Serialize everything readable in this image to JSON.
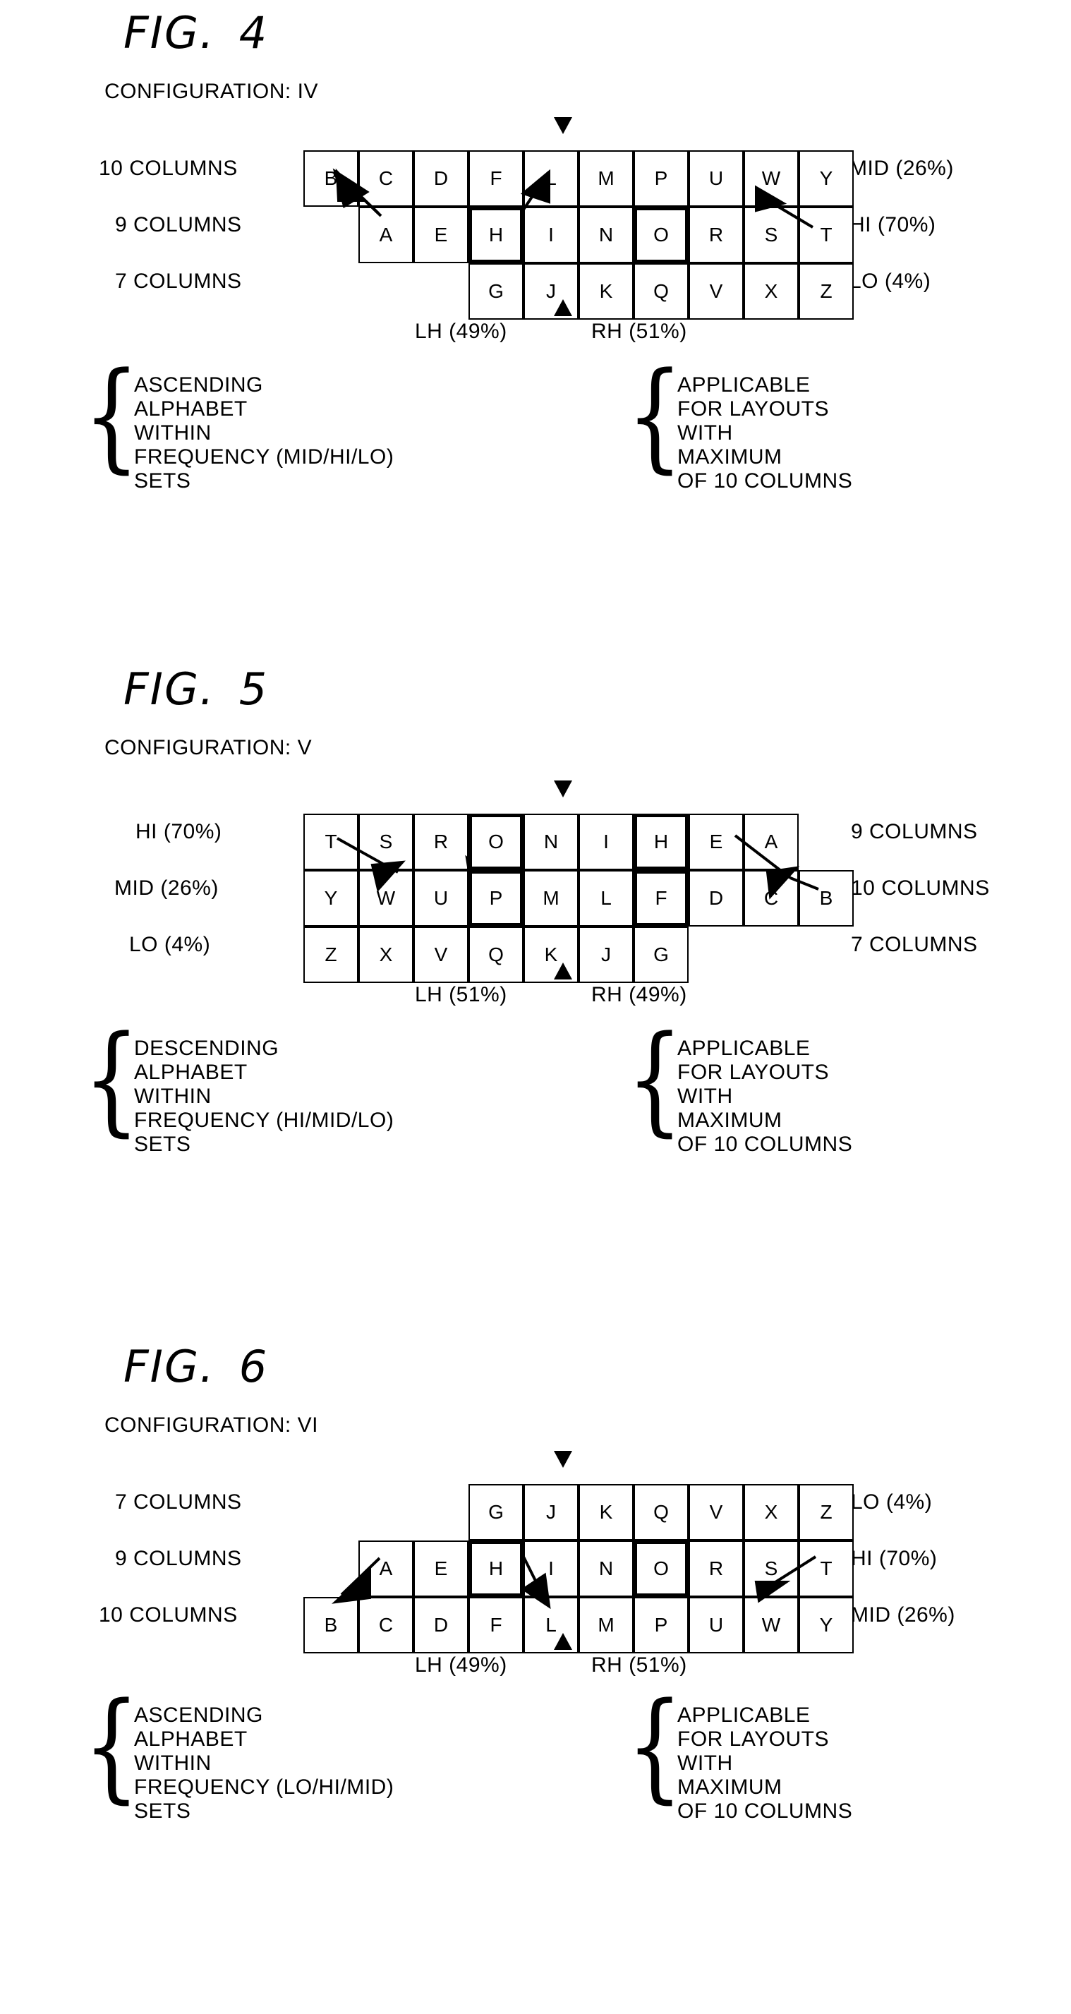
{
  "figures": [
    {
      "title_prefix": "FIG.",
      "title_number": "4",
      "configuration": "CONFIGURATION: IV",
      "rows": [
        {
          "left_label": "10 COLUMNS",
          "right_label": "MID (26%)",
          "offset": 0,
          "keys": [
            "B",
            "C",
            "D",
            "F",
            "L",
            "M",
            "P",
            "U",
            "W",
            "Y"
          ],
          "home_keys": []
        },
        {
          "left_label": "9 COLUMNS",
          "right_label": "HI (70%)",
          "offset": 1,
          "keys": [
            "A",
            "E",
            "H",
            "I",
            "N",
            "O",
            "R",
            "S",
            "T"
          ],
          "home_keys": [
            "H",
            "O"
          ]
        },
        {
          "left_label": "7 COLUMNS",
          "right_label": "LO (4%)",
          "offset": 3,
          "keys": [
            "G",
            "J",
            "K",
            "Q",
            "V",
            "X",
            "Z"
          ],
          "home_keys": []
        }
      ],
      "hand_left": "LH (49%)",
      "hand_right": "RH (51%)",
      "note_left": [
        "ASCENDING",
        "ALPHABET",
        "WITHIN",
        "FREQUENCY (MID/HI/LO)",
        "SETS"
      ],
      "note_right": [
        "APPLICABLE",
        "FOR LAYOUTS",
        "WITH",
        "MAXIMUM",
        "OF 10 COLUMNS"
      ]
    },
    {
      "title_prefix": "FIG.",
      "title_number": "5",
      "configuration": "CONFIGURATION: V",
      "rows": [
        {
          "left_label": "HI (70%)",
          "right_label": "9 COLUMNS",
          "offset": 0,
          "keys": [
            "T",
            "S",
            "R",
            "O",
            "N",
            "I",
            "H",
            "E",
            "A"
          ],
          "home_keys": [
            "O",
            "H"
          ]
        },
        {
          "left_label": "MID (26%)",
          "right_label": "10 COLUMNS",
          "offset": 0,
          "keys": [
            "Y",
            "W",
            "U",
            "P",
            "M",
            "L",
            "F",
            "D",
            "C",
            "B"
          ],
          "home_keys": [
            "P",
            "F"
          ]
        },
        {
          "left_label": "LO (4%)",
          "right_label": "7 COLUMNS",
          "offset": 0,
          "keys": [
            "Z",
            "X",
            "V",
            "Q",
            "K",
            "J",
            "G"
          ],
          "home_keys": []
        }
      ],
      "hand_left": "LH (51%)",
      "hand_right": "RH (49%)",
      "note_left": [
        "DESCENDING",
        "ALPHABET",
        "WITHIN",
        "FREQUENCY (HI/MID/LO)",
        "SETS"
      ],
      "note_right": [
        "APPLICABLE",
        "FOR LAYOUTS",
        "WITH",
        "MAXIMUM",
        "OF 10 COLUMNS"
      ]
    },
    {
      "title_prefix": "FIG.",
      "title_number": "6",
      "configuration": "CONFIGURATION: VI",
      "rows": [
        {
          "left_label": "7 COLUMNS",
          "right_label": "LO (4%)",
          "offset": 3,
          "keys": [
            "G",
            "J",
            "K",
            "Q",
            "V",
            "X",
            "Z"
          ],
          "home_keys": []
        },
        {
          "left_label": "9 COLUMNS",
          "right_label": "HI (70%)",
          "offset": 1,
          "keys": [
            "A",
            "E",
            "H",
            "I",
            "N",
            "O",
            "R",
            "S",
            "T"
          ],
          "home_keys": [
            "H",
            "O"
          ]
        },
        {
          "left_label": "10 COLUMNS",
          "right_label": "MID (26%)",
          "offset": 0,
          "keys": [
            "B",
            "C",
            "D",
            "F",
            "L",
            "M",
            "P",
            "U",
            "W",
            "Y"
          ],
          "home_keys": []
        }
      ],
      "hand_left": "LH (49%)",
      "hand_right": "RH (51%)",
      "note_left": [
        "ASCENDING",
        "ALPHABET",
        "WITHIN",
        "FREQUENCY (LO/HI/MID)",
        "SETS"
      ],
      "note_right": [
        "APPLICABLE",
        "FOR LAYOUTS",
        "WITH",
        "MAXIMUM",
        "OF 10 COLUMNS"
      ]
    }
  ],
  "brace": "{"
}
